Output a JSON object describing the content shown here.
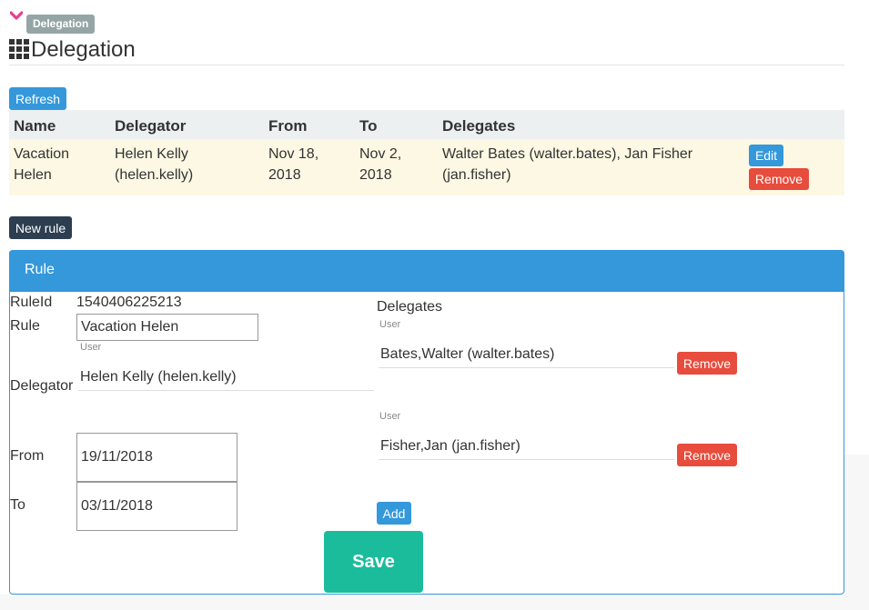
{
  "header": {
    "badge": "Delegation",
    "title": "Delegation"
  },
  "toolbar": {
    "refresh_label": "Refresh",
    "new_rule_label": "New rule"
  },
  "table": {
    "columns": [
      "Name",
      "Delegator",
      "From",
      "To",
      "Delegates"
    ],
    "rows": [
      {
        "name_line1": "Vacation",
        "name_line2": "Helen",
        "delegator_line1": "Helen Kelly",
        "delegator_line2": "(helen.kelly)",
        "from_line1": "Nov 18,",
        "from_line2": "2018",
        "to_line1": "Nov 2,",
        "to_line2": "2018",
        "delegates_line1": "Walter Bates (walter.bates), Jan Fisher",
        "delegates_line2": "(jan.fisher)",
        "edit_label": "Edit",
        "remove_label": "Remove"
      }
    ]
  },
  "panel": {
    "title": "Rule",
    "ruleid_label": "RuleId",
    "ruleid_value": "1540406225213",
    "rule_label": "Rule",
    "rule_value": "Vacation Helen",
    "user_caption": "User",
    "delegator_label": "Delegator",
    "delegator_value": "Helen Kelly (helen.kelly)",
    "from_label": "From",
    "from_value": "19/11/2018",
    "to_label": "To",
    "to_value": "03/11/2018",
    "delegates_label": "Delegates",
    "delegates": [
      {
        "caption": "User",
        "value": "Bates,Walter (walter.bates)",
        "remove_label": "Remove"
      },
      {
        "caption": "User",
        "value": "Fisher,Jan (jan.fisher)",
        "remove_label": "Remove"
      }
    ],
    "add_label": "Add",
    "save_label": "Save"
  },
  "colors": {
    "primary": "#3498db",
    "danger": "#e74c3c",
    "dark": "#2c3e50",
    "success": "#1abc9c",
    "row_highlight": "#fcf8e3",
    "header_row": "#ecf0f1",
    "heart": "#e83e8c"
  },
  "icons": {
    "chevron": "chevron-down-icon",
    "grid": "grid-icon"
  }
}
